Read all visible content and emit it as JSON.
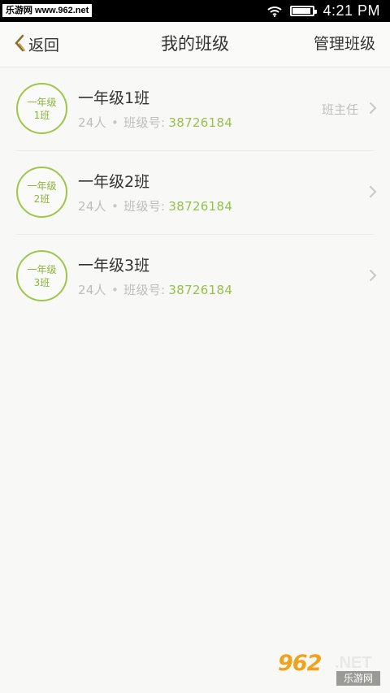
{
  "status_bar": {
    "watermark": "乐游网 www.962.net",
    "time": "4:21 PM",
    "battery_level_percent": 90,
    "icons": [
      "wifi-icon",
      "battery-icon"
    ]
  },
  "navbar": {
    "back_label": "返回",
    "title": "我的班级",
    "manage_label": "管理班级"
  },
  "classes": [
    {
      "badge_line1": "一年级",
      "badge_line2": "1班",
      "name": "一年级1班",
      "students": "24人",
      "dot": "•",
      "id_label": "班级号:",
      "id_value": "38726184",
      "role": "班主任"
    },
    {
      "badge_line1": "一年级",
      "badge_line2": "2班",
      "name": "一年级2班",
      "students": "24人",
      "dot": "•",
      "id_label": "班级号:",
      "id_value": "38726184",
      "role": ""
    },
    {
      "badge_line1": "一年级",
      "badge_line2": "3班",
      "name": "一年级3班",
      "students": "24人",
      "dot": "•",
      "id_label": "班级号:",
      "id_value": "38726184",
      "role": ""
    }
  ],
  "logo": {
    "number": "962",
    "suffix": ".NET",
    "cn": "乐游网"
  },
  "colors": {
    "accent": "#97c04a",
    "badge_border": "#9fc64a",
    "back_arrow": "#8a6d2c",
    "statusbar": "#000000"
  }
}
